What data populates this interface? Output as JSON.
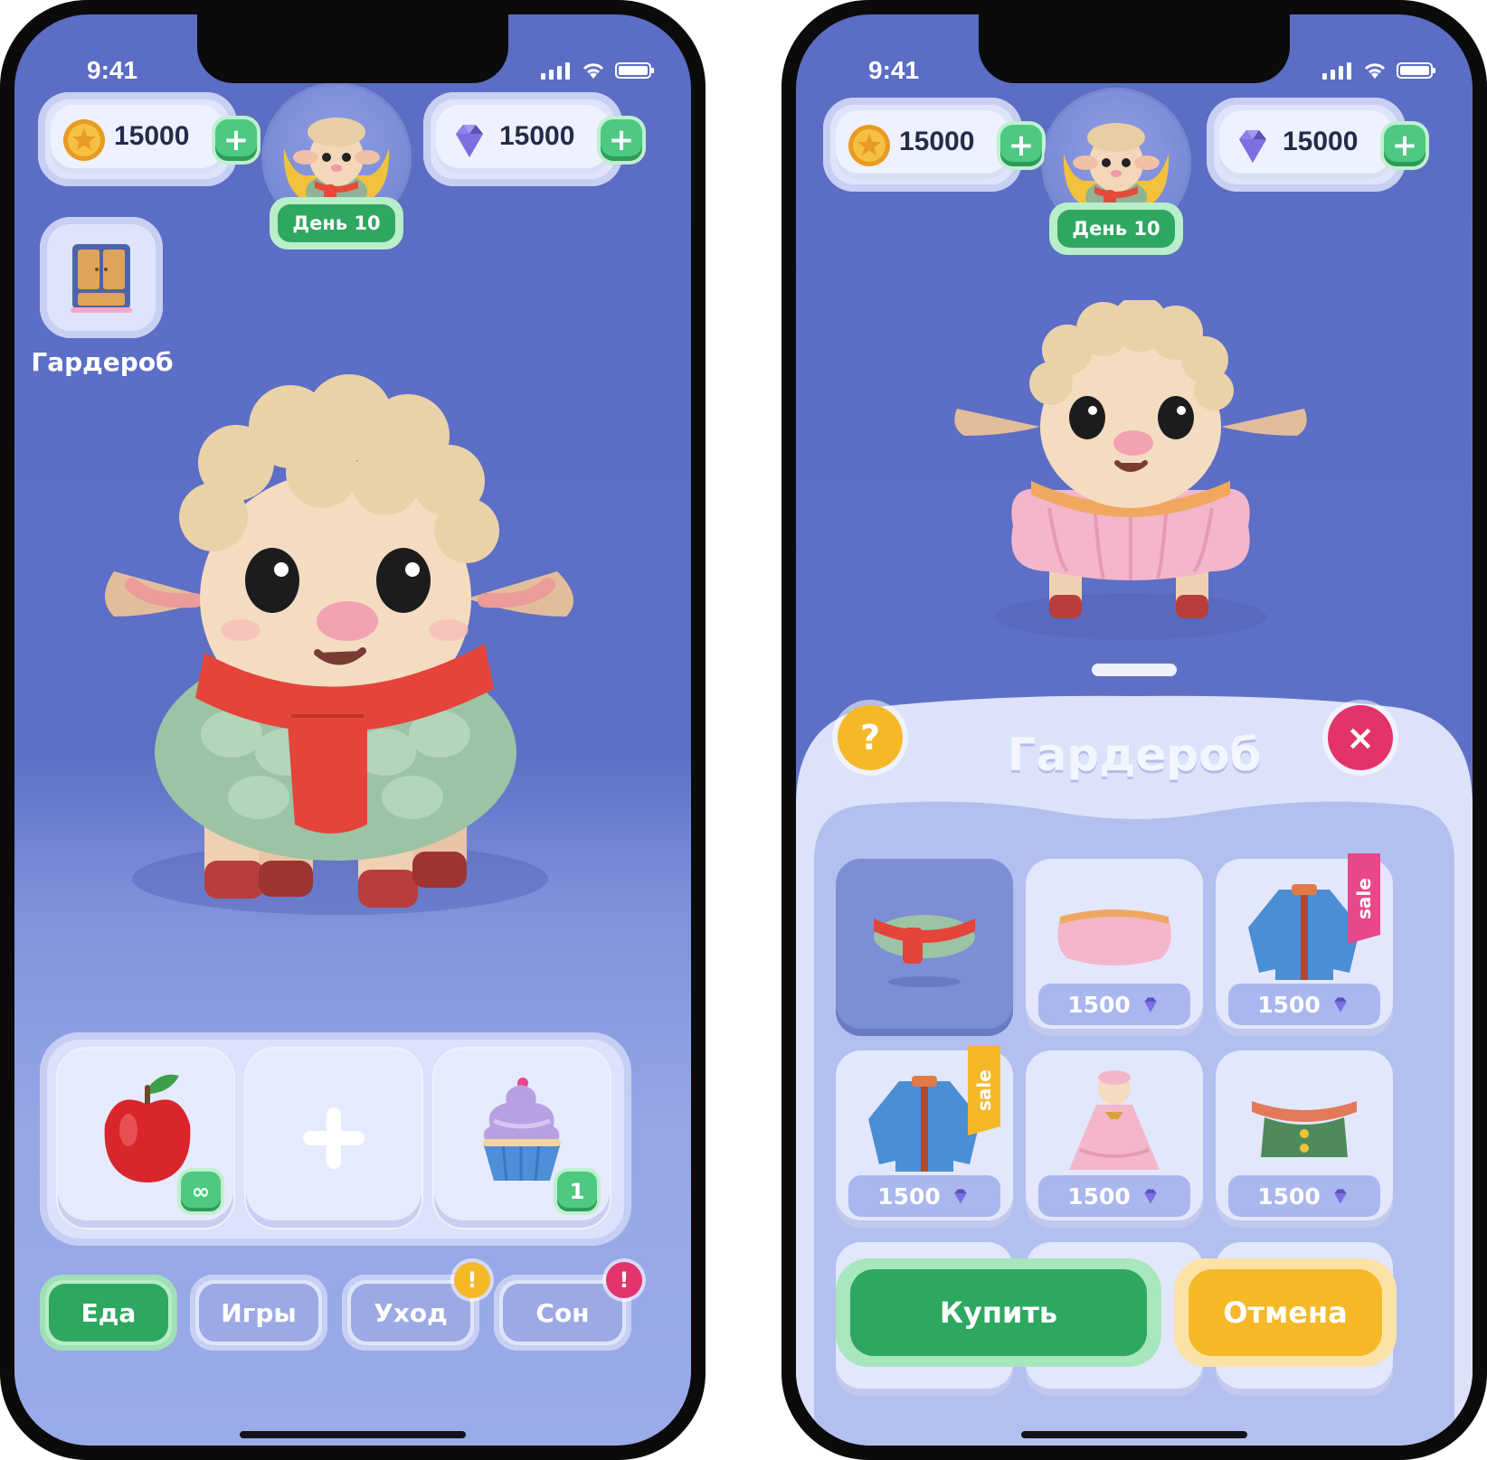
{
  "status_bar": {
    "time": "9:41"
  },
  "left_screen": {
    "coins": "15000",
    "gems": "15000",
    "day_badge": "День 10",
    "wardrobe_label": "Гардероб",
    "food_slots": [
      {
        "name": "apple",
        "count": "∞"
      },
      {
        "name": "add",
        "count": ""
      },
      {
        "name": "cupcake",
        "count": "1"
      }
    ],
    "tabs": [
      {
        "label": "Еда",
        "active": true,
        "alert": ""
      },
      {
        "label": "Игры",
        "active": false,
        "alert": ""
      },
      {
        "label": "Уход",
        "active": false,
        "alert": "!"
      },
      {
        "label": "Сон",
        "active": false,
        "alert": "!"
      }
    ]
  },
  "right_screen": {
    "coins": "15000",
    "gems": "15000",
    "day_badge": "День 10",
    "sheet_title": "Гардероб",
    "help_icon": "?",
    "close_icon": "×",
    "items": [
      {
        "name": "scarf",
        "price": "",
        "sale": ""
      },
      {
        "name": "pink skirt",
        "price": "1500",
        "sale": ""
      },
      {
        "name": "blue jacket",
        "price": "1500",
        "sale": "sale"
      },
      {
        "name": "blue jacket",
        "price": "1500",
        "sale": "sale"
      },
      {
        "name": "pink dress",
        "price": "1500",
        "sale": ""
      },
      {
        "name": "green collar",
        "price": "1500",
        "sale": ""
      }
    ],
    "buy_label": "Купить",
    "cancel_label": "Отмена"
  },
  "colors": {
    "background": "#5b6dc4",
    "green": "#2ea860",
    "yellow": "#f5b928",
    "pink_alert": "#e8478a",
    "close_red": "#e2336a"
  }
}
